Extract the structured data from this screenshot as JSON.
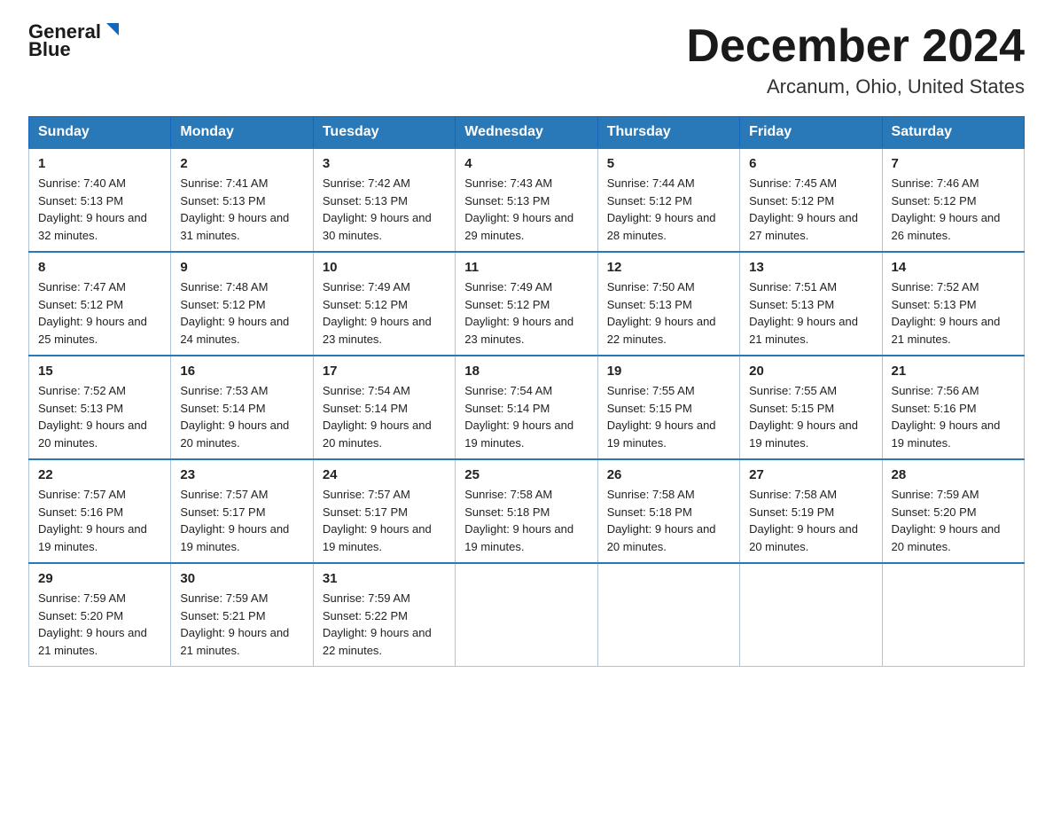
{
  "header": {
    "logo_line1": "General",
    "logo_line2": "Blue",
    "month_title": "December 2024",
    "location": "Arcanum, Ohio, United States"
  },
  "days_of_week": [
    "Sunday",
    "Monday",
    "Tuesday",
    "Wednesday",
    "Thursday",
    "Friday",
    "Saturday"
  ],
  "weeks": [
    [
      {
        "day": "1",
        "sunrise": "7:40 AM",
        "sunset": "5:13 PM",
        "daylight": "9 hours and 32 minutes."
      },
      {
        "day": "2",
        "sunrise": "7:41 AM",
        "sunset": "5:13 PM",
        "daylight": "9 hours and 31 minutes."
      },
      {
        "day": "3",
        "sunrise": "7:42 AM",
        "sunset": "5:13 PM",
        "daylight": "9 hours and 30 minutes."
      },
      {
        "day": "4",
        "sunrise": "7:43 AM",
        "sunset": "5:13 PM",
        "daylight": "9 hours and 29 minutes."
      },
      {
        "day": "5",
        "sunrise": "7:44 AM",
        "sunset": "5:12 PM",
        "daylight": "9 hours and 28 minutes."
      },
      {
        "day": "6",
        "sunrise": "7:45 AM",
        "sunset": "5:12 PM",
        "daylight": "9 hours and 27 minutes."
      },
      {
        "day": "7",
        "sunrise": "7:46 AM",
        "sunset": "5:12 PM",
        "daylight": "9 hours and 26 minutes."
      }
    ],
    [
      {
        "day": "8",
        "sunrise": "7:47 AM",
        "sunset": "5:12 PM",
        "daylight": "9 hours and 25 minutes."
      },
      {
        "day": "9",
        "sunrise": "7:48 AM",
        "sunset": "5:12 PM",
        "daylight": "9 hours and 24 minutes."
      },
      {
        "day": "10",
        "sunrise": "7:49 AM",
        "sunset": "5:12 PM",
        "daylight": "9 hours and 23 minutes."
      },
      {
        "day": "11",
        "sunrise": "7:49 AM",
        "sunset": "5:12 PM",
        "daylight": "9 hours and 23 minutes."
      },
      {
        "day": "12",
        "sunrise": "7:50 AM",
        "sunset": "5:13 PM",
        "daylight": "9 hours and 22 minutes."
      },
      {
        "day": "13",
        "sunrise": "7:51 AM",
        "sunset": "5:13 PM",
        "daylight": "9 hours and 21 minutes."
      },
      {
        "day": "14",
        "sunrise": "7:52 AM",
        "sunset": "5:13 PM",
        "daylight": "9 hours and 21 minutes."
      }
    ],
    [
      {
        "day": "15",
        "sunrise": "7:52 AM",
        "sunset": "5:13 PM",
        "daylight": "9 hours and 20 minutes."
      },
      {
        "day": "16",
        "sunrise": "7:53 AM",
        "sunset": "5:14 PM",
        "daylight": "9 hours and 20 minutes."
      },
      {
        "day": "17",
        "sunrise": "7:54 AM",
        "sunset": "5:14 PM",
        "daylight": "9 hours and 20 minutes."
      },
      {
        "day": "18",
        "sunrise": "7:54 AM",
        "sunset": "5:14 PM",
        "daylight": "9 hours and 19 minutes."
      },
      {
        "day": "19",
        "sunrise": "7:55 AM",
        "sunset": "5:15 PM",
        "daylight": "9 hours and 19 minutes."
      },
      {
        "day": "20",
        "sunrise": "7:55 AM",
        "sunset": "5:15 PM",
        "daylight": "9 hours and 19 minutes."
      },
      {
        "day": "21",
        "sunrise": "7:56 AM",
        "sunset": "5:16 PM",
        "daylight": "9 hours and 19 minutes."
      }
    ],
    [
      {
        "day": "22",
        "sunrise": "7:57 AM",
        "sunset": "5:16 PM",
        "daylight": "9 hours and 19 minutes."
      },
      {
        "day": "23",
        "sunrise": "7:57 AM",
        "sunset": "5:17 PM",
        "daylight": "9 hours and 19 minutes."
      },
      {
        "day": "24",
        "sunrise": "7:57 AM",
        "sunset": "5:17 PM",
        "daylight": "9 hours and 19 minutes."
      },
      {
        "day": "25",
        "sunrise": "7:58 AM",
        "sunset": "5:18 PM",
        "daylight": "9 hours and 19 minutes."
      },
      {
        "day": "26",
        "sunrise": "7:58 AM",
        "sunset": "5:18 PM",
        "daylight": "9 hours and 20 minutes."
      },
      {
        "day": "27",
        "sunrise": "7:58 AM",
        "sunset": "5:19 PM",
        "daylight": "9 hours and 20 minutes."
      },
      {
        "day": "28",
        "sunrise": "7:59 AM",
        "sunset": "5:20 PM",
        "daylight": "9 hours and 20 minutes."
      }
    ],
    [
      {
        "day": "29",
        "sunrise": "7:59 AM",
        "sunset": "5:20 PM",
        "daylight": "9 hours and 21 minutes."
      },
      {
        "day": "30",
        "sunrise": "7:59 AM",
        "sunset": "5:21 PM",
        "daylight": "9 hours and 21 minutes."
      },
      {
        "day": "31",
        "sunrise": "7:59 AM",
        "sunset": "5:22 PM",
        "daylight": "9 hours and 22 minutes."
      },
      null,
      null,
      null,
      null
    ]
  ]
}
